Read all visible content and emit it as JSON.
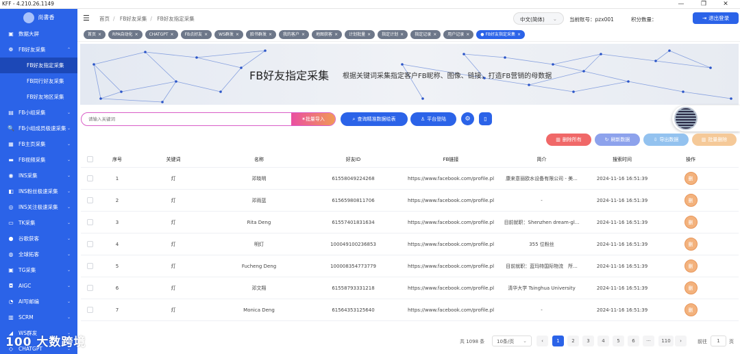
{
  "window": {
    "title": "KFF - 4.210.26.1149",
    "minimize": "—",
    "maximize": "❐",
    "close": "✕"
  },
  "sidebar": {
    "logo_text": "尚書香",
    "items": [
      {
        "label": "数据大屏",
        "icon": "▣",
        "chev": ""
      },
      {
        "label": "FB好友采集",
        "icon": "❁",
        "chev": "⌃"
      },
      {
        "label": "FB好友指定采集",
        "icon": "",
        "chev": "",
        "sub": true,
        "active": true
      },
      {
        "label": "FB同行好友采集",
        "icon": "",
        "chev": "",
        "sub": true
      },
      {
        "label": "FB好友地区采集",
        "icon": "",
        "chev": "",
        "sub": true
      },
      {
        "label": "FB小组采集",
        "icon": "▤",
        "chev": "⌄"
      },
      {
        "label": "FB小组成员极速采集",
        "icon": "🔍",
        "chev": "⌄"
      },
      {
        "label": "FB主页采集",
        "icon": "▦",
        "chev": "⌄"
      },
      {
        "label": "FB视频采集",
        "icon": "▬",
        "chev": "⌄"
      },
      {
        "label": "INS采集",
        "icon": "◉",
        "chev": "⌄"
      },
      {
        "label": "INS粉丝极速采集",
        "icon": "◧",
        "chev": "⌄"
      },
      {
        "label": "INS关注极速采集",
        "icon": "◎",
        "chev": "⌄"
      },
      {
        "label": "TK采集",
        "icon": "▭",
        "chev": "⌄"
      },
      {
        "label": "谷歌获客",
        "icon": "●",
        "chev": "⌄"
      },
      {
        "label": "全球拓客",
        "icon": "◍",
        "chev": "⌄"
      },
      {
        "label": "TG采集",
        "icon": "▣",
        "chev": "⌄"
      },
      {
        "label": "AIGC",
        "icon": "◘",
        "chev": "⌄"
      },
      {
        "label": "AI写邮编",
        "icon": "◔",
        "chev": "⌄"
      },
      {
        "label": "SCRM",
        "icon": "▥",
        "chev": "⌄"
      },
      {
        "label": "WS群发",
        "icon": "◢",
        "chev": "⌄"
      },
      {
        "label": "CHATGPT",
        "icon": "◇",
        "chev": "⌄"
      }
    ]
  },
  "header": {
    "breadcrumb": [
      "首页",
      "FB好友采集",
      "FB好友指定采集"
    ],
    "language": "中文(简体)",
    "account": "当前账号：pzx001",
    "points": "积分数量：",
    "logout": "退出登录"
  },
  "tabs": [
    {
      "label": "首页"
    },
    {
      "label": "RPA自动化"
    },
    {
      "label": "CHATGPT"
    },
    {
      "label": "FB点好友"
    },
    {
      "label": "WS群发"
    },
    {
      "label": "脸书群发"
    },
    {
      "label": "我的客户"
    },
    {
      "label": "地图获客"
    },
    {
      "label": "计划批量"
    },
    {
      "label": "指定计划"
    },
    {
      "label": "指定记录"
    },
    {
      "label": "用户记录"
    },
    {
      "label": "FB好友指定采集",
      "active": true
    }
  ],
  "banner": {
    "title": "FB好友指定采集",
    "subtitle": "根据关键词采集指定客户FB昵称、图像、链接，打造FB营销的母数据"
  },
  "search": {
    "placeholder": "请输入关键词",
    "import": "批量导入"
  },
  "toolbar": {
    "query": "查询精准数据绘表",
    "platform": "平台登陆",
    "icon1": "⚙",
    "icon2": "▯"
  },
  "actions": {
    "delete_all": "删除所有",
    "refresh": "刷新数据",
    "export": "导出数据",
    "batch_delete": "批量删除"
  },
  "table": {
    "columns": [
      "",
      "序号",
      "关键词",
      "名称",
      "好友ID",
      "FB链接",
      "简介",
      "搜索时间",
      "操作"
    ],
    "rows": [
      {
        "no": "1",
        "kw": "灯",
        "name": "邓晓明",
        "id": "61558049224268",
        "link": "https://www.facebook.com/profile.pl",
        "intro": "康来意丽欧水设备有限公司 - 美...",
        "time": "2024-11-16 16:51:39",
        "op": "删"
      },
      {
        "no": "2",
        "kw": "灯",
        "name": "邓雨蓝",
        "id": "61565980811706",
        "link": "https://www.facebook.com/profile.pl",
        "intro": "-",
        "time": "2024-11-16 16:51:39",
        "op": "删"
      },
      {
        "no": "3",
        "kw": "灯",
        "name": "Rita Deng",
        "id": "61557401831634",
        "link": "https://www.facebook.com/profile.pl",
        "intro": "目前就职：Shenzhen dream-gl...",
        "time": "2024-11-16 16:51:39",
        "op": "删"
      },
      {
        "no": "4",
        "kw": "灯",
        "name": "明灯",
        "id": "100049100236853",
        "link": "https://www.facebook.com/profile.pl",
        "intro": "355 位粉丝",
        "time": "2024-11-16 16:51:39",
        "op": "删"
      },
      {
        "no": "5",
        "kw": "灯",
        "name": "Fucheng Deng",
        "id": "100008354773779",
        "link": "https://www.facebook.com/profile.pl",
        "intro": "目前就职：蓝玛特国际物流　所...",
        "time": "2024-11-16 16:51:39",
        "op": "删"
      },
      {
        "no": "6",
        "kw": "灯",
        "name": "邓文翔",
        "id": "61558793331218",
        "link": "https://www.facebook.com/profile.pl",
        "intro": "清华大学 Tsinghua University",
        "time": "2024-11-16 16:51:39",
        "op": "删"
      },
      {
        "no": "7",
        "kw": "灯",
        "name": "Monica Deng",
        "id": "61564353125640",
        "link": "https://www.facebook.com/profile.pl",
        "intro": "-",
        "time": "2024-11-16 16:51:39",
        "op": "删"
      }
    ]
  },
  "pager": {
    "total": "共 1098 条",
    "size": "10条/页",
    "pages": [
      "1",
      "2",
      "3",
      "4",
      "5",
      "6",
      "···",
      "110"
    ],
    "prev": "‹",
    "next": "›",
    "goto": "前往",
    "page": "1",
    "unit": "页"
  },
  "watermark": "100 大数跨境",
  "colors": {
    "primary": "#2b63e8",
    "sidebar_active": "#1c48b7",
    "danger": "#f06868",
    "accent": "#f3b27d"
  }
}
